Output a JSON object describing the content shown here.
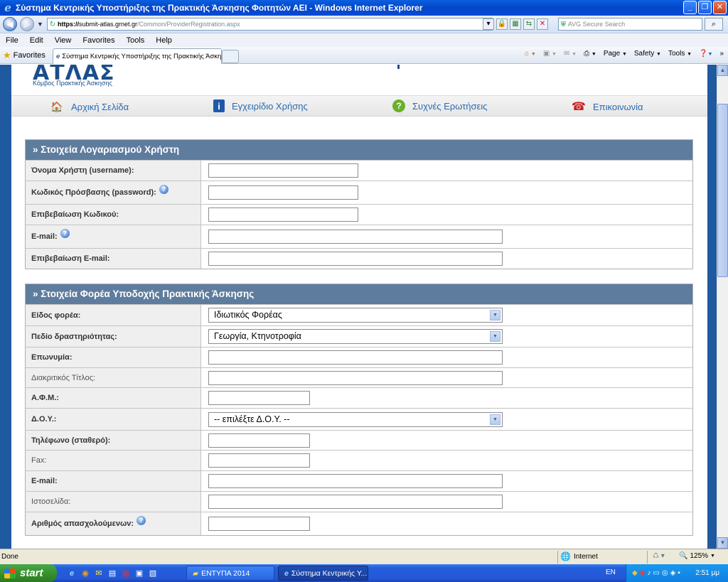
{
  "window": {
    "title": "Σύστημα Κεντρικής Υποστήριξης της Πρακτικής Άσκησης Φοιτητών ΑΕΙ - Windows Internet Explorer"
  },
  "address": {
    "scheme": "https://",
    "host": "submit-atlas.grnet.gr",
    "path": "/Common/ProviderRegistration.aspx",
    "search_placeholder": "AVG Secure Search"
  },
  "menu": [
    "File",
    "Edit",
    "View",
    "Favorites",
    "Tools",
    "Help"
  ],
  "favorites_bar": {
    "favorites_label": "Favorites",
    "tab_title": "Σύστημα Κεντρικής Υποστήριξης της Πρακτικής Άσκησ..."
  },
  "command_bar": {
    "page": "Page",
    "safety": "Safety",
    "tools": "Tools"
  },
  "site": {
    "logo_text": "ΑΤΛΑΣ",
    "logo_subtitle": "Κόμβος Πρακτικής Άσκησης",
    "nav": [
      {
        "label": "Αρχική Σελίδα",
        "icon": "home-icon"
      },
      {
        "label": "Εγχειρίδιο Χρήσης",
        "icon": "info-icon"
      },
      {
        "label": "Συχνές Ερωτήσεις",
        "icon": "faq-icon"
      },
      {
        "label": "Επικοινωνία",
        "icon": "phone-icon"
      }
    ]
  },
  "account_section": {
    "title": "» Στοιχεία Λογαριασμού Χρήστη",
    "fields": [
      {
        "label": "Όνομα Χρήστη (username):",
        "value": ""
      },
      {
        "label": "Κωδικός Πρόσβασης (password):",
        "value": "",
        "help": true
      },
      {
        "label": "Επιβεβαίωση Κωδικού:",
        "value": ""
      },
      {
        "label": "E-mail:",
        "value": "",
        "help": true
      },
      {
        "label": "Επιβεβαίωση E-mail:",
        "value": ""
      }
    ]
  },
  "provider_section": {
    "title": "» Στοιχεία Φορέα Υποδοχής Πρακτικής Άσκησης",
    "fields": [
      {
        "label": "Είδος φορέα:",
        "type": "select",
        "value": "Ιδιωτικός Φορέας"
      },
      {
        "label": "Πεδίο δραστηριότητας:",
        "type": "select",
        "value": "Γεωργία, Κτηνοτροφία"
      },
      {
        "label": "Επωνυμία:",
        "type": "input",
        "value": ""
      },
      {
        "label": "Διακριτικός Τίτλος:",
        "type": "input",
        "value": "",
        "optional": true
      },
      {
        "label": "Α.Φ.Μ.:",
        "type": "input",
        "value": ""
      },
      {
        "label": "Δ.Ο.Υ.:",
        "type": "select",
        "value": "-- επιλέξτε Δ.Ο.Υ. --"
      },
      {
        "label": "Τηλέφωνο (σταθερό):",
        "type": "input",
        "value": ""
      },
      {
        "label": "Fax:",
        "type": "input",
        "value": "",
        "optional": true
      },
      {
        "label": "E-mail:",
        "type": "input",
        "value": ""
      },
      {
        "label": "Ιστοσελίδα:",
        "type": "input",
        "value": "",
        "optional": true
      },
      {
        "label": "Αριθμός απασχολούμενων:",
        "type": "input",
        "value": "",
        "help": true
      }
    ]
  },
  "status": {
    "text": "Done",
    "zone": "Internet",
    "zoom": "125%"
  },
  "taskbar": {
    "start": "start",
    "tasks": [
      "ΕΝΤΥΠΑ 2014",
      "Σύστημα Κεντρικής Υ..."
    ],
    "lang": "EN",
    "clock": "2:51 μμ"
  }
}
